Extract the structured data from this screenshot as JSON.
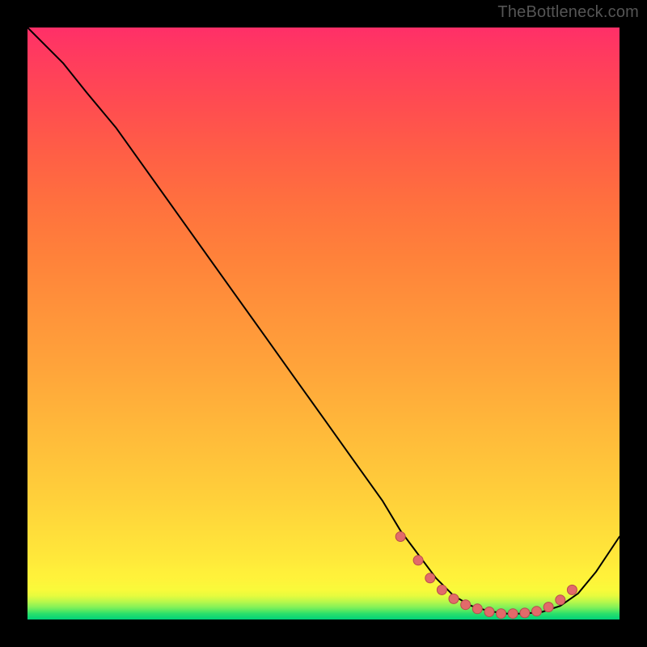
{
  "watermark": "TheBottleneck.com",
  "chart_data": {
    "type": "line",
    "title": "",
    "xlabel": "",
    "ylabel": "",
    "xlim": [
      0,
      100
    ],
    "ylim": [
      0,
      100
    ],
    "grid": false,
    "legend": false,
    "background_gradient": {
      "bottom": "#00d17a",
      "top": "#ff2f68",
      "description": "green→yellow→orange→red vertical gradient"
    },
    "series": [
      {
        "name": "bottleneck-curve",
        "x": [
          0,
          6,
          10,
          15,
          20,
          25,
          30,
          35,
          40,
          45,
          50,
          55,
          60,
          63,
          66,
          69,
          72,
          75,
          78,
          81,
          84,
          87,
          90,
          93,
          96,
          100
        ],
        "y": [
          100,
          94,
          89,
          83,
          76,
          69,
          62,
          55,
          48,
          41,
          34,
          27,
          20,
          15,
          11,
          7,
          4,
          2.3,
          1.4,
          1.0,
          1.0,
          1.3,
          2.3,
          4.4,
          8.0,
          14
        ]
      }
    ],
    "markers": {
      "comment": "pink dots clustered near the valley",
      "x": [
        63,
        66,
        68,
        70,
        72,
        74,
        76,
        78,
        80,
        82,
        84,
        86,
        88,
        90,
        92
      ],
      "y": [
        14,
        10,
        7,
        5,
        3.5,
        2.5,
        1.8,
        1.3,
        1.0,
        1.0,
        1.1,
        1.4,
        2.1,
        3.3,
        5.0
      ]
    }
  }
}
